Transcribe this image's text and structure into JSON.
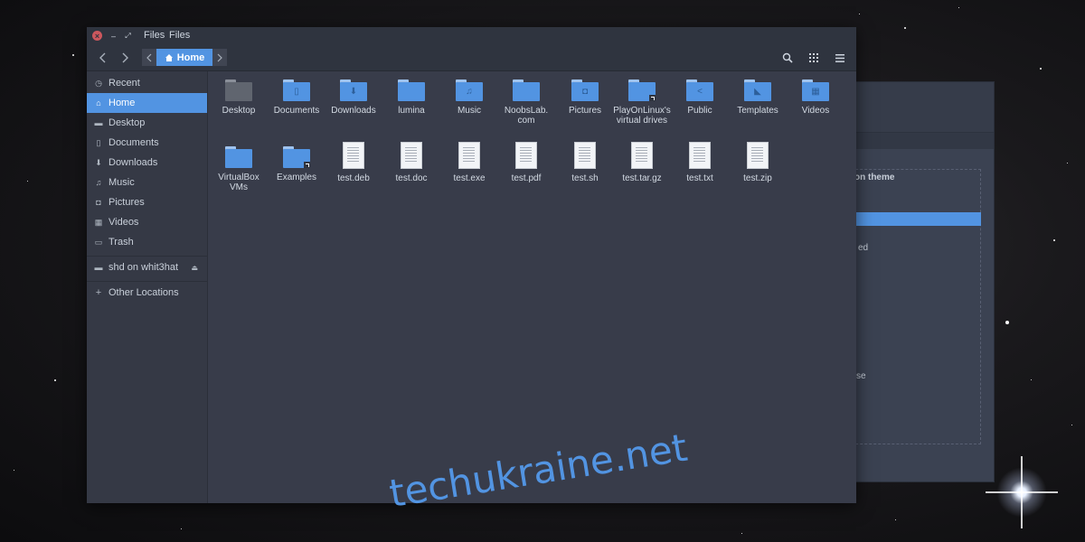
{
  "window": {
    "title_left": "Files",
    "title_right": "Files"
  },
  "toolbar": {
    "path_label": "Home"
  },
  "sidebar": {
    "items": [
      {
        "label": "Recent",
        "icon": "clock-icon"
      },
      {
        "label": "Home",
        "icon": "home-icon",
        "active": true
      },
      {
        "label": "Desktop",
        "icon": "desktop-icon"
      },
      {
        "label": "Documents",
        "icon": "document-icon"
      },
      {
        "label": "Downloads",
        "icon": "download-icon"
      },
      {
        "label": "Music",
        "icon": "music-icon"
      },
      {
        "label": "Pictures",
        "icon": "camera-icon"
      },
      {
        "label": "Videos",
        "icon": "video-icon"
      },
      {
        "label": "Trash",
        "icon": "trash-icon"
      }
    ],
    "devices": [
      {
        "label": "shd on whit3hat",
        "icon": "drive-icon"
      }
    ],
    "other": {
      "label": "Other Locations",
      "icon": "plus-icon"
    }
  },
  "files": {
    "row1": [
      {
        "label": "Desktop",
        "kind": "folder-grey"
      },
      {
        "label": "Documents",
        "kind": "folder",
        "glyph": "document-icon"
      },
      {
        "label": "Downloads",
        "kind": "folder",
        "glyph": "download-icon"
      },
      {
        "label": "lumina",
        "kind": "folder"
      },
      {
        "label": "Music",
        "kind": "folder",
        "glyph": "music-icon"
      },
      {
        "label": "NoobsLab.com",
        "kind": "folder"
      },
      {
        "label": "Pictures",
        "kind": "folder",
        "glyph": "camera-icon"
      },
      {
        "label": "PlayOnLinux's virtual drives",
        "kind": "folder-link"
      },
      {
        "label": "Public",
        "kind": "folder",
        "glyph": "share-icon"
      },
      {
        "label": "Templates",
        "kind": "folder",
        "glyph": "template-icon"
      },
      {
        "label": "Videos",
        "kind": "folder",
        "glyph": "film-icon"
      }
    ],
    "row2": [
      {
        "label": "VirtualBox VMs",
        "kind": "folder"
      },
      {
        "label": "Examples",
        "kind": "folder-link"
      },
      {
        "label": "test.deb",
        "kind": "doc"
      },
      {
        "label": "test.doc",
        "kind": "doc"
      },
      {
        "label": "test.exe",
        "kind": "doc"
      },
      {
        "label": "test.pdf",
        "kind": "doc"
      },
      {
        "label": "test.sh",
        "kind": "doc"
      },
      {
        "label": "test.tar.gz",
        "kind": "doc"
      },
      {
        "label": "test.txt",
        "kind": "doc"
      },
      {
        "label": "test.zip",
        "kind": "doc"
      }
    ]
  },
  "background_window": {
    "heading_fragment": "on theme",
    "line1": "ed",
    "line2": "se"
  },
  "watermark": "techukraine.net",
  "colors": {
    "accent": "#5294e2",
    "window_bg": "#383c4a",
    "sidebar_bg": "#353945",
    "titlebar_bg": "#2f343f",
    "close_button": "#cc575d"
  }
}
